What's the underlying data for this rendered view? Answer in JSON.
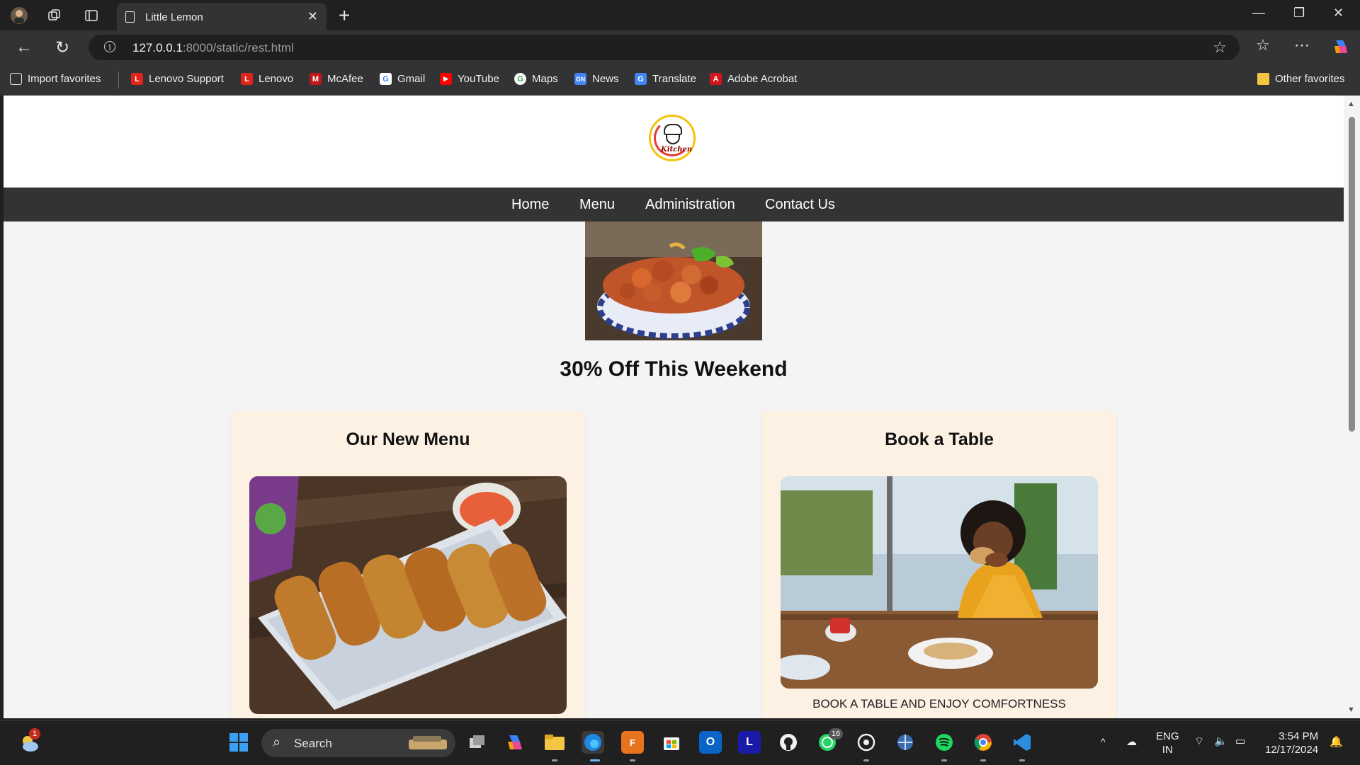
{
  "browser": {
    "tab_title": "Little Lemon",
    "url_host": "127.0.0.1",
    "url_path": ":8000/static/rest.html"
  },
  "favorites": {
    "import": "Import favorites",
    "items": [
      "Lenovo Support",
      "Lenovo",
      "McAfee",
      "Gmail",
      "YouTube",
      "Maps",
      "News",
      "Translate",
      "Adobe Acrobat"
    ],
    "other": "Other favorites"
  },
  "site": {
    "logo_text": "Kitchen",
    "nav": [
      "Home",
      "Menu",
      "Administration",
      "Contact Us"
    ],
    "promo": "30% Off This Weekend",
    "cards": [
      {
        "title": "Our New Menu",
        "caption": ""
      },
      {
        "title": "Book a Table",
        "caption": "BOOK A TABLE AND ENJOY COMFORTNESS"
      }
    ]
  },
  "taskbar": {
    "search_label": "Search",
    "weather_badge": "1",
    "whatsapp_badge": "16",
    "lang_line1": "ENG",
    "lang_line2": "IN",
    "time": "3:54 PM",
    "date": "12/17/2024"
  }
}
